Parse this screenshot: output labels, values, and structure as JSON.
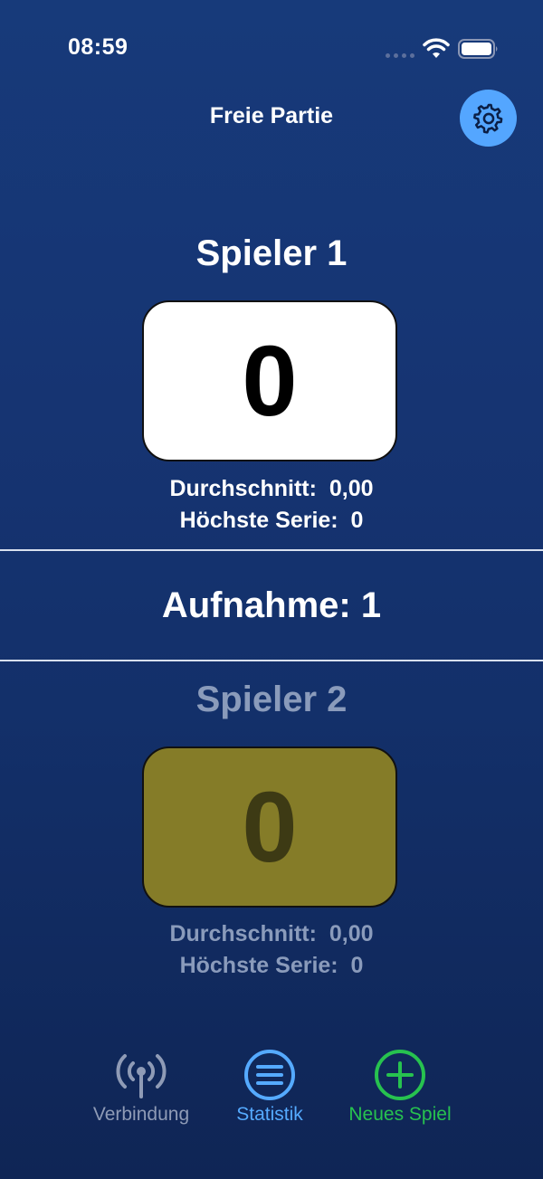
{
  "status_bar": {
    "time": "08:59"
  },
  "nav": {
    "title": "Freie Partie",
    "settings_icon": "gear-icon"
  },
  "player1": {
    "name": "Spieler 1",
    "score": "0",
    "average_label": "Durchschnitt:",
    "average_value": "0,00",
    "best_series_label": "Höchste Serie:",
    "best_series_value": "0",
    "box_color": "#ffffff"
  },
  "inning": {
    "label": "Aufnahme:",
    "value": "1"
  },
  "player2": {
    "name": "Spieler 2",
    "score": "0",
    "average_label": "Durchschnitt:",
    "average_value": "0,00",
    "best_series_label": "Höchste Serie:",
    "best_series_value": "0",
    "box_color": "#857c28"
  },
  "tabs": [
    {
      "label": "Verbindung",
      "icon": "antenna-icon",
      "color": "#8f9bb6"
    },
    {
      "label": "Statistik",
      "icon": "list-icon",
      "color": "#55aaff"
    },
    {
      "label": "Neues Spiel",
      "icon": "plus-circle-icon",
      "color": "#27c24f"
    }
  ],
  "colors": {
    "accent_blue": "#54a6ff",
    "background_top": "#173a7a",
    "background_bottom": "#0f2555"
  }
}
